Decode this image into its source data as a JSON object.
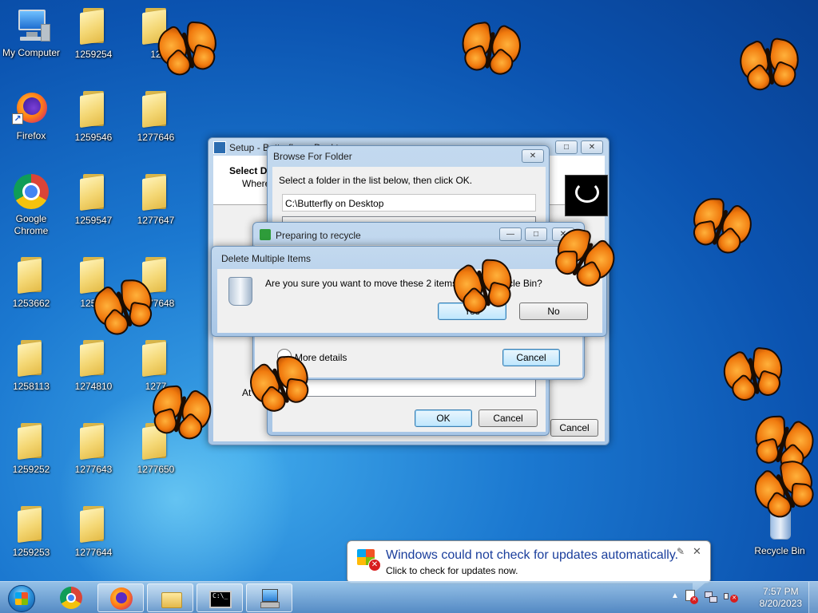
{
  "desktop_icons": [
    {
      "label": "My Computer",
      "kind": "computer"
    },
    {
      "label": "1259254",
      "kind": "folder"
    },
    {
      "label": "12",
      "kind": "folder"
    },
    {
      "label": "Firefox",
      "kind": "firefox"
    },
    {
      "label": "1259546",
      "kind": "folder"
    },
    {
      "label": "1277646",
      "kind": "folder"
    },
    {
      "label": "Google Chrome",
      "kind": "chrome"
    },
    {
      "label": "1259547",
      "kind": "folder"
    },
    {
      "label": "1277647",
      "kind": "folder"
    },
    {
      "label": "1253662",
      "kind": "folder"
    },
    {
      "label": "12595",
      "kind": "folder"
    },
    {
      "label": "1277648",
      "kind": "folder"
    },
    {
      "label": "1258113",
      "kind": "folder"
    },
    {
      "label": "1274810",
      "kind": "folder"
    },
    {
      "label": "1277",
      "kind": "folder"
    },
    {
      "label": "1259252",
      "kind": "folder"
    },
    {
      "label": "1277643",
      "kind": "folder"
    },
    {
      "label": "1277650",
      "kind": "folder"
    },
    {
      "label": "1259253",
      "kind": "folder"
    },
    {
      "label": "1277644",
      "kind": "folder"
    },
    {
      "label": "Recycle Bin",
      "kind": "recycle-bin"
    }
  ],
  "setup_window": {
    "title": "Setup - Butterfly on Deskt",
    "heading": "Select D",
    "subheading": "Where",
    "footer_text": "At l",
    "cancel_label": "Cancel"
  },
  "browse_dialog": {
    "title": "Browse For Folder",
    "instruction": "Select a folder in the list below, then click OK.",
    "path_value": "C:\\Butterfly on Desktop",
    "ok_label": "OK",
    "cancel_label": "Cancel"
  },
  "recycle_progress": {
    "title": "Preparing to recycle",
    "more_details_label": "More details",
    "cancel_label": "Cancel"
  },
  "delete_dialog": {
    "title": "Delete Multiple Items",
    "message": "Are you sure you want to move these 2 items to the Recycle Bin?",
    "yes_label": "Yes",
    "no_label": "No"
  },
  "notification": {
    "title": "Windows could not check for updates automatically.",
    "body": "Click to check for updates now."
  },
  "taskbar": {
    "items": [
      {
        "name": "chrome",
        "active": false
      },
      {
        "name": "firefox",
        "active": true
      },
      {
        "name": "explorer",
        "active": true
      },
      {
        "name": "command-prompt",
        "active": true
      },
      {
        "name": "setup-installer",
        "active": true
      }
    ],
    "time": "7:57 PM",
    "date": "8/20/2023"
  },
  "colors": {
    "accent": "#1b78d0",
    "butterfly": "#f07a0e",
    "link_blue": "#1a3e9c"
  }
}
